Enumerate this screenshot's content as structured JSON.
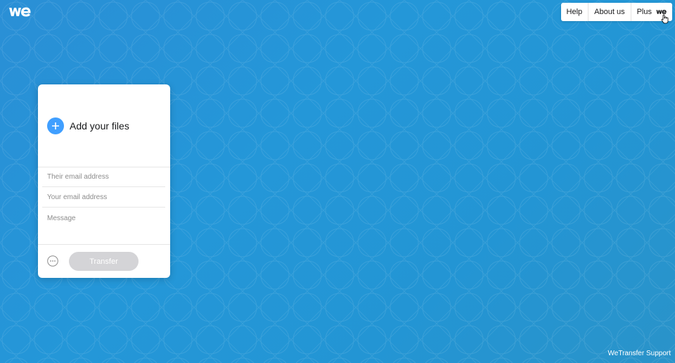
{
  "brand": {
    "logo_icon": "wetransfer-logo-icon"
  },
  "nav": {
    "help": "Help",
    "about": "About us",
    "plus": "Plus",
    "plus_icon": "wetransfer-logo-icon"
  },
  "panel": {
    "add_files_icon": "plus-icon",
    "add_files_label": "Add your files",
    "their_email_placeholder": "Their email address",
    "your_email_placeholder": "Your email address",
    "message_placeholder": "Message",
    "more_icon": "more-options-icon",
    "transfer_label": "Transfer"
  },
  "footer": {
    "support_label": "WeTransfer Support"
  },
  "colors": {
    "background": "#2495d6",
    "accent": "#409fff",
    "button_disabled": "#d4d4d7"
  }
}
